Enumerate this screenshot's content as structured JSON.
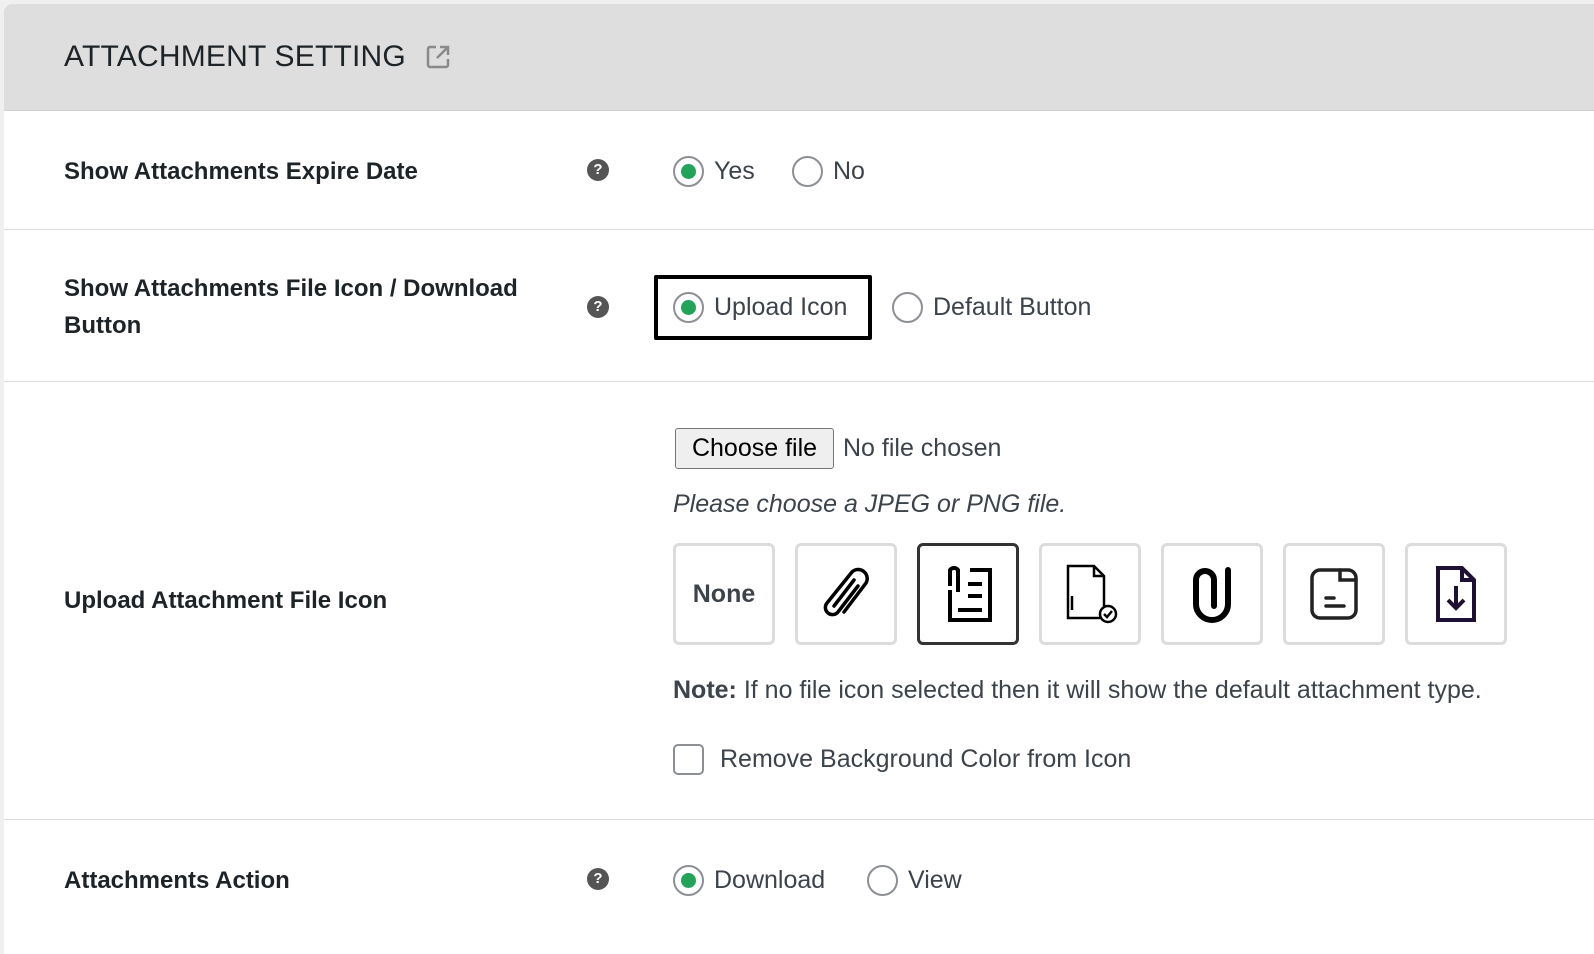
{
  "header": {
    "title": "ATTACHMENT SETTING",
    "icon": "external-link-icon"
  },
  "rows": {
    "expire": {
      "label": "Show Attachments Expire Date",
      "options": [
        "Yes",
        "No"
      ],
      "selected": "Yes"
    },
    "file_icon": {
      "label": "Show Attachments File Icon / Download Button",
      "options": [
        "Upload Icon",
        "Default Button"
      ],
      "selected": "Upload Icon"
    },
    "upload": {
      "label": "Upload Attachment File Icon",
      "choose_file": "Choose file",
      "no_file": "No file chosen",
      "hint": "Please choose a JPEG or PNG file.",
      "none_label": "None",
      "icons": [
        "none",
        "paperclip-icon",
        "clip-document-icon",
        "file-check-icon",
        "bold-paperclip-icon",
        "note-document-icon",
        "file-download-icon"
      ],
      "selected_icon": "clip-document-icon",
      "note_label": "Note:",
      "note_text": " If no file icon selected then it will show the default attachment type.",
      "checkbox_label": "Remove Background Color from Icon"
    },
    "action": {
      "label": "Attachments Action",
      "options": [
        "Download",
        "View"
      ],
      "selected": "Download"
    }
  },
  "help_glyph": "?",
  "colors": {
    "accent": "#21a35a",
    "header_bg": "#dedede"
  }
}
